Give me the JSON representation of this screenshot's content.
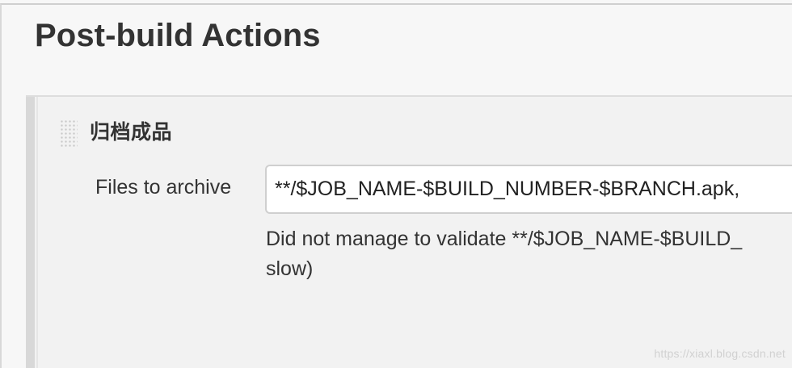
{
  "section": {
    "title": "Post-build Actions"
  },
  "step": {
    "title": "归档成品",
    "field": {
      "label": "Files to archive",
      "value": "**/$JOB_NAME-$BUILD_NUMBER-$BRANCH.apk,",
      "validation_line1": "Did not manage to validate **/$JOB_NAME-$BUILD_",
      "validation_line2": "slow)"
    }
  },
  "watermark": {
    "text": "https://xiaxl.blog.csdn.net"
  },
  "icons": {
    "drag": "drag-handle-icon"
  }
}
